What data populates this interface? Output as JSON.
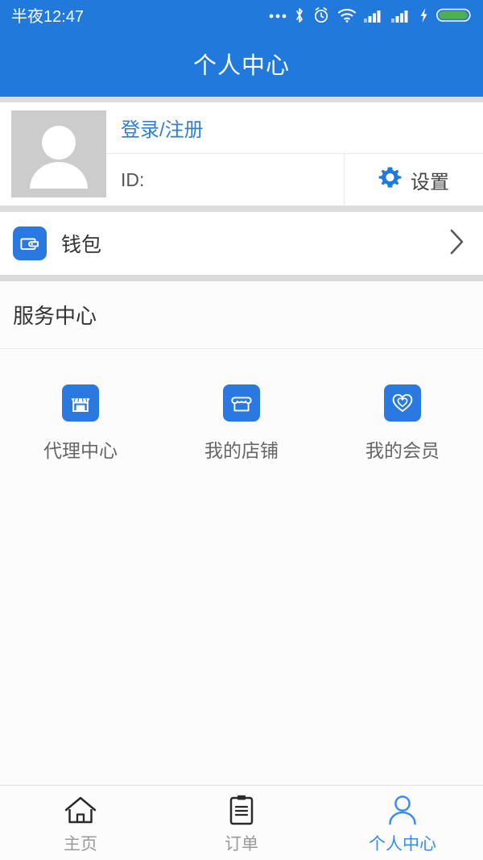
{
  "status_bar": {
    "time": "半夜12:47",
    "icons": [
      "more-ellipsis-icon",
      "bluetooth-icon",
      "alarm-clock-icon",
      "wifi-icon",
      "signal-bars-icon",
      "signal-bars-secondary-icon",
      "charging-bolt-icon",
      "battery-icon"
    ],
    "battery_color": "#4caf50"
  },
  "header": {
    "title": "个人中心",
    "background": "#2079db"
  },
  "profile": {
    "avatar_icon": "user-placeholder-icon",
    "login_label": "登录/注册",
    "id_label": "ID:",
    "settings_label": "设置",
    "settings_icon": "gear-icon",
    "link_color": "#2f7fd6"
  },
  "wallet": {
    "icon": "wallet-icon",
    "label": "钱包",
    "chevron": "chevron-right-icon"
  },
  "service_center": {
    "title": "服务中心",
    "items": [
      {
        "label": "代理中心",
        "icon": "agent-store-icon"
      },
      {
        "label": "我的店铺",
        "icon": "my-shop-icon"
      },
      {
        "label": "我的会员",
        "icon": "heart-members-icon"
      }
    ],
    "icon_color": "#2979e0"
  },
  "bottom_nav": {
    "active_color": "#3b8cf0",
    "inactive_color": "#9a9a9a",
    "items": [
      {
        "label": "主页",
        "icon": "home-icon",
        "active": false
      },
      {
        "label": "订单",
        "icon": "clipboard-orders-icon",
        "active": false
      },
      {
        "label": "个人中心",
        "icon": "person-icon",
        "active": true
      }
    ]
  }
}
